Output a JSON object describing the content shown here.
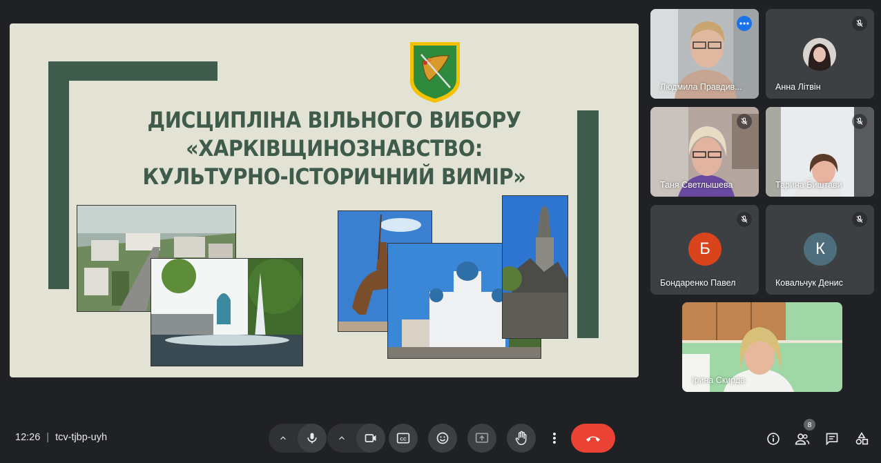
{
  "slide": {
    "title_lines": [
      "ДИСЦИПЛІНА ВІЛЬНОГО ВИБОРУ",
      "«ХАРКІВЩИНОЗНАВСТВО:",
      "КУЛЬТУРНО-ІСТОРИЧНИЙ ВИМІР»"
    ],
    "accent_color": "#3f5b4b",
    "background_color": "#e2e2d5"
  },
  "participants": [
    {
      "name": "Людмила Правдив...",
      "type": "video",
      "active": true,
      "muted": false
    },
    {
      "name": "Анна Літвін",
      "type": "avatar-photo",
      "muted": true
    },
    {
      "name": "Таня Светлышева",
      "type": "video",
      "muted": true
    },
    {
      "name": "Тарина Биштави",
      "type": "video",
      "muted": true
    },
    {
      "name": "Бондаренко Павел",
      "type": "letter",
      "letter": "Б",
      "avatar_color": "#d9441c",
      "muted": true
    },
    {
      "name": "Ковальчук Денис",
      "type": "letter",
      "letter": "К",
      "avatar_color": "#4e6e7e",
      "muted": true
    },
    {
      "name": "Ірина Скирда",
      "type": "video",
      "muted": false
    }
  ],
  "bottom_bar": {
    "time": "12:26",
    "separator": "|",
    "meeting_code": "tcv-tjbp-uyh",
    "people_count": "8",
    "end_call_color": "#ea4335"
  },
  "icons": {
    "mic": "mic-icon",
    "camera": "camera-icon",
    "captions": "captions-icon",
    "emoji": "emoji-icon",
    "present": "present-screen-icon",
    "hand": "raise-hand-icon",
    "more": "more-options-icon",
    "end": "end-call-icon",
    "info": "info-icon",
    "people": "people-icon",
    "chat": "chat-icon",
    "activities": "activities-icon"
  }
}
